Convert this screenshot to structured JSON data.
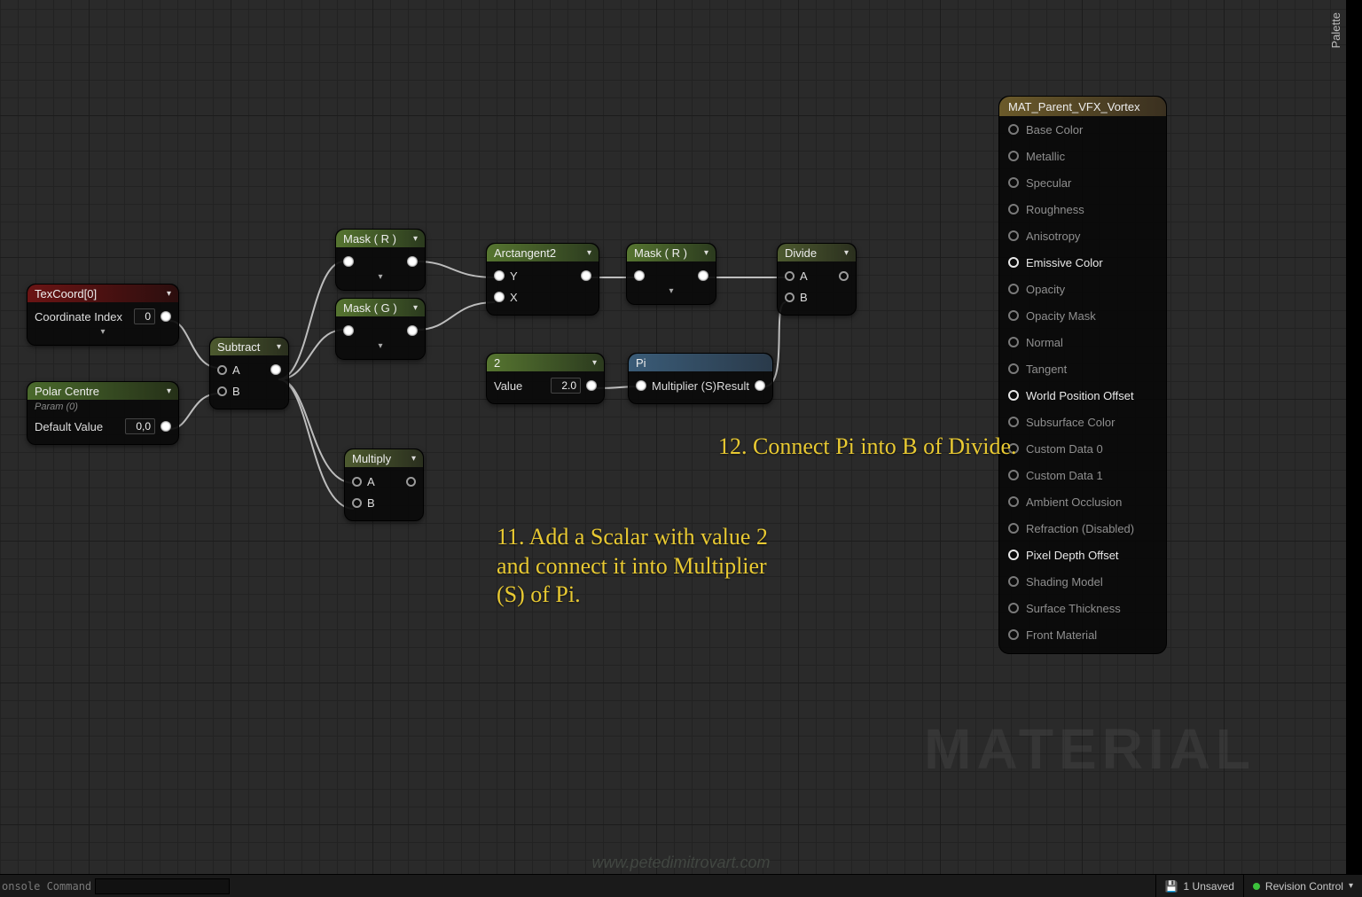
{
  "palette_label": "Palette",
  "watermark": "MATERIAL",
  "site_url": "www.petedimitrovart.com",
  "bottom": {
    "console_label": "onsole Command",
    "unsaved_icon": "disk",
    "unsaved_text": "1 Unsaved",
    "revision_text": "Revision Control"
  },
  "annotations": {
    "a11": "11. Add a Scalar with value 2 and connect it into Multiplier (S) of Pi.",
    "a12": "12. Connect Pi into B of Divide."
  },
  "nodes": {
    "texcoord": {
      "title": "TexCoord[0]",
      "field_label": "Coordinate Index",
      "field_value": "0"
    },
    "polar": {
      "title": "Polar Centre",
      "sub": "Param (0)",
      "field_label": "Default Value",
      "field_value": "0,0"
    },
    "subtract": {
      "title": "Subtract",
      "a": "A",
      "b": "B"
    },
    "mask_r": {
      "title": "Mask ( R )"
    },
    "mask_g": {
      "title": "Mask ( G )"
    },
    "multiply": {
      "title": "Multiply",
      "a": "A",
      "b": "B"
    },
    "atan2": {
      "title": "Arctangent2",
      "y": "Y",
      "x": "X"
    },
    "mask_r2": {
      "title": "Mask ( R )"
    },
    "scalar2": {
      "title": "2",
      "val_label": "Value",
      "val": "2.0"
    },
    "pi": {
      "title": "Pi",
      "mult": "Multiplier (S)",
      "res": "Result"
    },
    "divide": {
      "title": "Divide",
      "a": "A",
      "b": "B"
    }
  },
  "output_panel": {
    "title": "MAT_Parent_VFX_Vortex",
    "pins": [
      {
        "label": "Base Color",
        "active": false
      },
      {
        "label": "Metallic",
        "active": false
      },
      {
        "label": "Specular",
        "active": false
      },
      {
        "label": "Roughness",
        "active": false
      },
      {
        "label": "Anisotropy",
        "active": false
      },
      {
        "label": "Emissive Color",
        "active": true
      },
      {
        "label": "Opacity",
        "active": false
      },
      {
        "label": "Opacity Mask",
        "active": false
      },
      {
        "label": "Normal",
        "active": false
      },
      {
        "label": "Tangent",
        "active": false
      },
      {
        "label": "World Position Offset",
        "active": true
      },
      {
        "label": "Subsurface Color",
        "active": false
      },
      {
        "label": "Custom Data 0",
        "active": false
      },
      {
        "label": "Custom Data 1",
        "active": false
      },
      {
        "label": "Ambient Occlusion",
        "active": false
      },
      {
        "label": "Refraction (Disabled)",
        "active": false
      },
      {
        "label": "Pixel Depth Offset",
        "active": true
      },
      {
        "label": "Shading Model",
        "active": false
      },
      {
        "label": "Surface Thickness",
        "active": false
      },
      {
        "label": "Front Material",
        "active": false
      }
    ]
  }
}
